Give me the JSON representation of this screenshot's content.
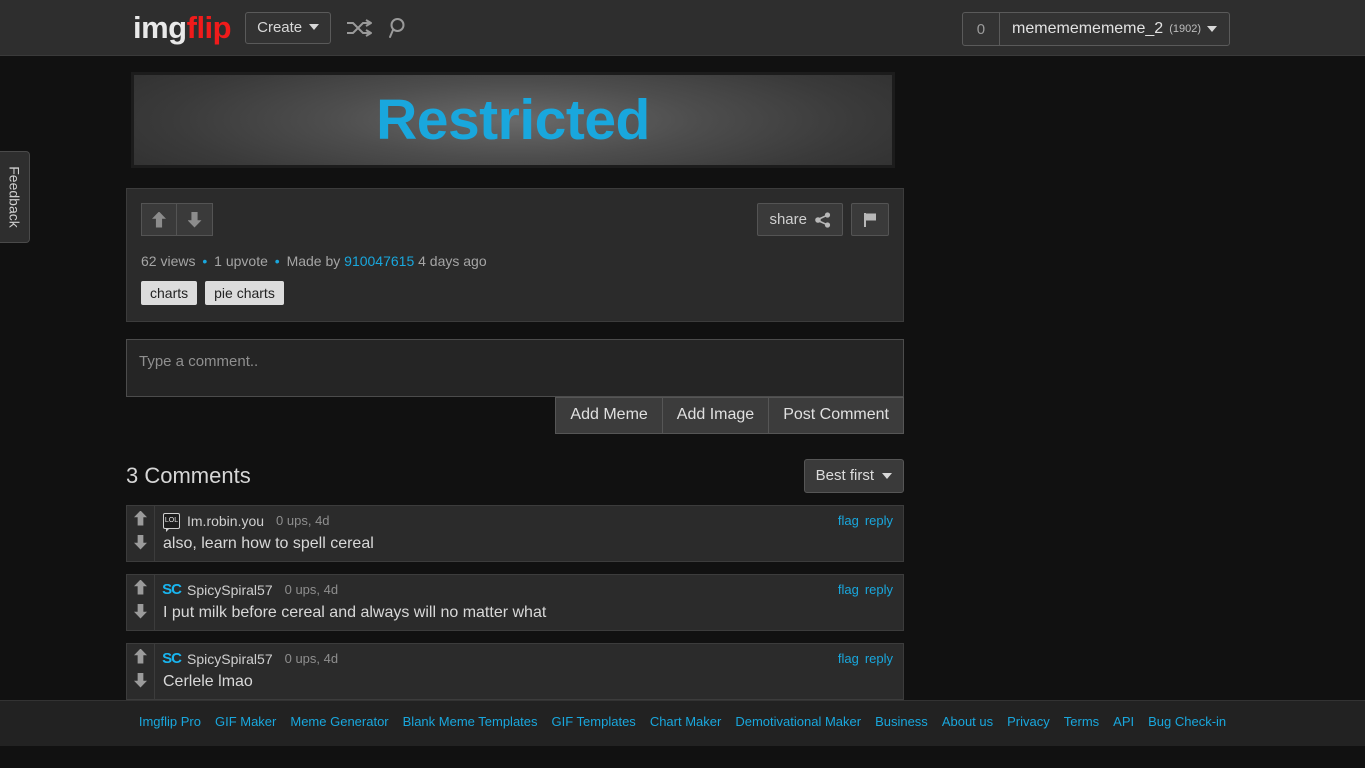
{
  "header": {
    "logo_img": "img",
    "logo_flip": "flip",
    "create_label": "Create",
    "shuffle_icon": "shuffle-icon",
    "search_icon": "search-icon",
    "points": "0",
    "username": "memememememe_2",
    "user_points": "(1902)"
  },
  "feedback": {
    "label": "Feedback"
  },
  "meme": {
    "text": "Restricted"
  },
  "meta": {
    "views": "62 views",
    "upvotes": "1 upvote",
    "made_by_prefix": "Made by",
    "author": "910047615",
    "age": "4 days ago",
    "tags": [
      "charts",
      "pie charts"
    ],
    "share_label": "share",
    "flag_icon": "flag-icon"
  },
  "comment_form": {
    "placeholder": "Type a comment..",
    "value": "",
    "add_meme": "Add Meme",
    "add_image": "Add Image",
    "post_comment": "Post Comment"
  },
  "comments_section": {
    "title": "3 Comments",
    "sort_label": "Best first",
    "flag_label": "flag",
    "reply_label": "reply",
    "items": [
      {
        "avatar_kind": "lol",
        "avatar_text": "LOL",
        "username": "Im.robin.you",
        "meta": "0 ups, 4d",
        "text": "also, learn how to spell cereal"
      },
      {
        "avatar_kind": "sc",
        "avatar_text": "SC",
        "username": "SpicySpiral57",
        "meta": "0 ups, 4d",
        "text": "I put milk before cereal and always will no matter what"
      },
      {
        "avatar_kind": "sc",
        "avatar_text": "SC",
        "username": "SpicySpiral57",
        "meta": "0 ups, 4d",
        "text": "Cerlele lmao"
      }
    ]
  },
  "footer": {
    "links": [
      "Imgflip Pro",
      "GIF Maker",
      "Meme Generator",
      "Blank Meme Templates",
      "GIF Templates",
      "Chart Maker",
      "Demotivational Maker",
      "Business",
      "About us",
      "Privacy",
      "Terms",
      "API",
      "Bug Check-in"
    ]
  },
  "colors": {
    "accent_blue": "#19a7dd",
    "logo_red": "#f01b1b",
    "meme_text": "#19a7dd"
  }
}
